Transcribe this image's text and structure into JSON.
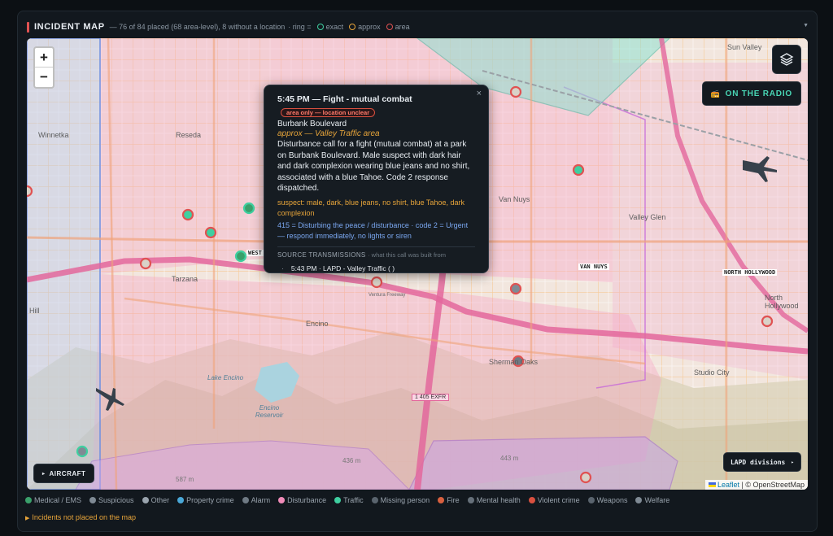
{
  "header": {
    "title": "INCIDENT MAP",
    "summary": "— 76 of 84 placed (68 area-level), 8 without a location",
    "ring_label": "· ring =",
    "rings": [
      {
        "label": "exact",
        "color": "#3fcfa0"
      },
      {
        "label": "approx",
        "color": "#e8a53a"
      },
      {
        "label": "area",
        "color": "#e05252"
      }
    ]
  },
  "map": {
    "labels": {
      "sun_valley": "Sun Valley",
      "winnetka": "Winnetka",
      "reseda": "Reseda",
      "van_nuys": "Van Nuys",
      "valley_glen": "Valley Glen",
      "tarzana": "Tarzana",
      "encino": "Encino",
      "sherman_oaks": "Sherman Oaks",
      "studio_city": "Studio City",
      "north_hollywood": "North Hollywood",
      "north_hollywood_div": "NORTH HOLLYWOOD",
      "van_nuys_div": "VAN NUYS",
      "west_div": "WEST",
      "lake_encino": "Lake Encino",
      "encino_reservoir": "Encino Reservoir",
      "ventura_freeway": "Ventura Freeway",
      "exit": "1 405 EXFR",
      "hill": "Hill",
      "elev_587": "587 m",
      "elev_436": "436 m",
      "elev_443": "443 m"
    },
    "zoom_in": "+",
    "zoom_out": "−",
    "radio_label": "ON THE RADIO",
    "aircraft_label": "AIRCRAFT",
    "divisions_label": "LAPD divisions",
    "attribution_leaflet": "Leaflet",
    "attribution_osm": "| © OpenStreetMap"
  },
  "popup": {
    "title": "5:45 PM — Fight - mutual combat",
    "chip": "area only — location unclear",
    "location": "Burbank Boulevard",
    "approx": "approx — Valley Traffic area",
    "description": "Disturbance call for a fight (mutual combat) at a park on Burbank Boulevard. Male suspect with dark hair and dark complexion wearing blue jeans and no shirt, associated with a blue Tahoe. Code 2 response dispatched.",
    "suspect": "suspect: male, dark, blue jeans, no shirt, blue Tahoe, dark complexion",
    "codes": "415 = Disturbing the peace / disturbance · code 2 = Urgent — respond immediately, no lights or siren",
    "source_heading": "SOURCE TRANSMISSIONS",
    "source_sub": "· what this call was built from",
    "transmission": "5:43 PM · LAPD - Valley Traffic ( )",
    "close": "×"
  },
  "legend": [
    {
      "label": "Medical / EMS",
      "color": "#3aa06b"
    },
    {
      "label": "Suspicious",
      "color": "#7f8a94"
    },
    {
      "label": "Other",
      "color": "#9aa4ae"
    },
    {
      "label": "Property crime",
      "color": "#4aa8d8"
    },
    {
      "label": "Alarm",
      "color": "#6f7a84"
    },
    {
      "label": "Disturbance",
      "color": "#f08bb8"
    },
    {
      "label": "Traffic",
      "color": "#3fcfa0"
    },
    {
      "label": "Missing person",
      "color": "#5a646e"
    },
    {
      "label": "Fire",
      "color": "#d9603f"
    },
    {
      "label": "Mental health",
      "color": "#66707a"
    },
    {
      "label": "Violent crime",
      "color": "#d9503f"
    },
    {
      "label": "Weapons",
      "color": "#5a646e"
    },
    {
      "label": "Welfare",
      "color": "#7f8a94"
    }
  ],
  "unplaced_label": "Incidents not placed on the map"
}
